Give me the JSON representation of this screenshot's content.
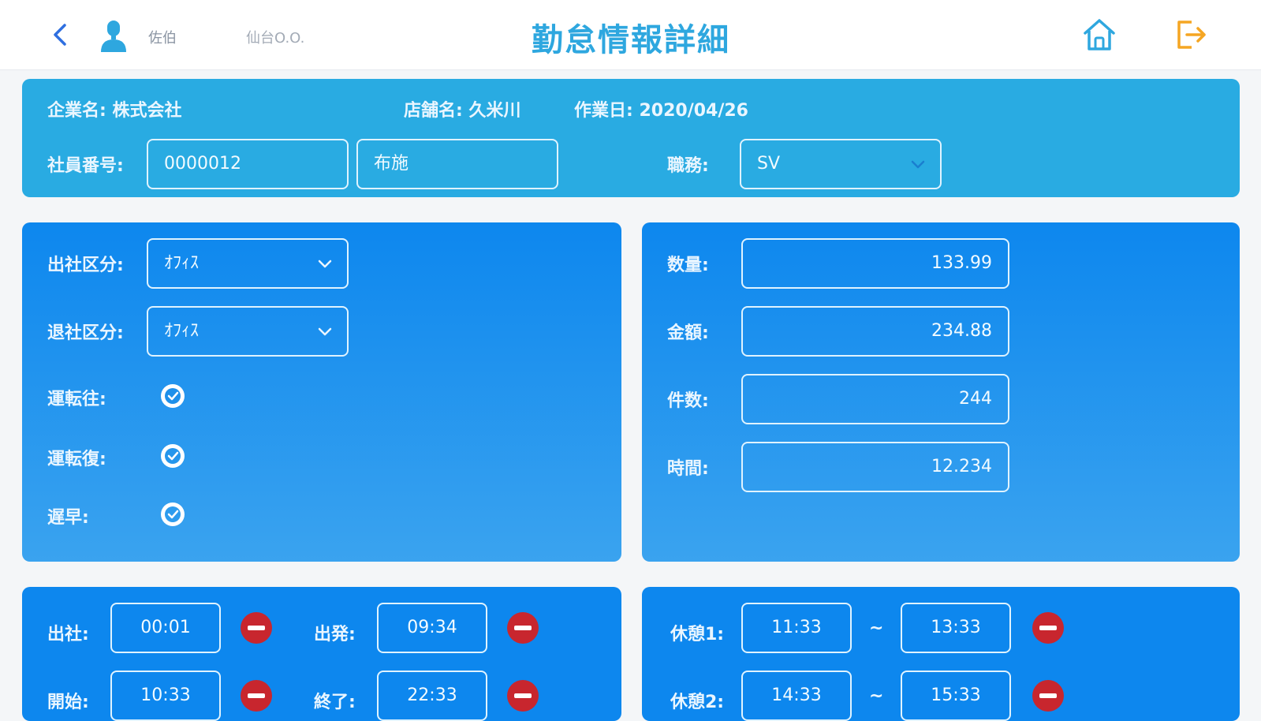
{
  "header": {
    "user_name": "佐伯",
    "store_name": "仙台O.O.",
    "title": "勤怠情報詳細",
    "accent": "#2ea7df",
    "logout_color": "#f5a623",
    "icons": [
      "back-chevron-icon",
      "user-icon",
      "home-icon",
      "logout-icon"
    ]
  },
  "info": {
    "company": "企業名: 株式会社",
    "store": "店舗名: 久米川",
    "work_date": "作業日: 2020/04/26",
    "employee_no_label": "社員番号:",
    "employee_no": "0000012",
    "employee_name": "布施",
    "position_label": "職務:",
    "position_value": "SV"
  },
  "attendance": {
    "arrival_label": "出社区分:",
    "arrival_value": "ｵﾌｨｽ",
    "leave_label": "退社区分:",
    "leave_value": "ｵﾌｨｽ",
    "drive_out_label": "運転往:",
    "drive_back_label": "運転復:",
    "early_label": "遅早:"
  },
  "metrics": {
    "quantity_label": "数量:",
    "quantity": "133.99",
    "amount_label": "金額:",
    "amount": "234.88",
    "count_label": "件数:",
    "count": "244",
    "time_label": "時間:",
    "time": "12.234"
  },
  "times": {
    "arrive_label": "出社:",
    "arrive": "00:01",
    "depart_label": "出発:",
    "depart": "09:34",
    "start_label": "開始:",
    "start": "10:33",
    "end_label": "終了:",
    "end": "22:33"
  },
  "breaks": {
    "break1_label": "休憩1:",
    "break1_from": "11:33",
    "break1_to": "13:33",
    "break2_label": "休憩2:",
    "break2_from": "14:33",
    "break2_to": "15:33",
    "separator": "~"
  }
}
